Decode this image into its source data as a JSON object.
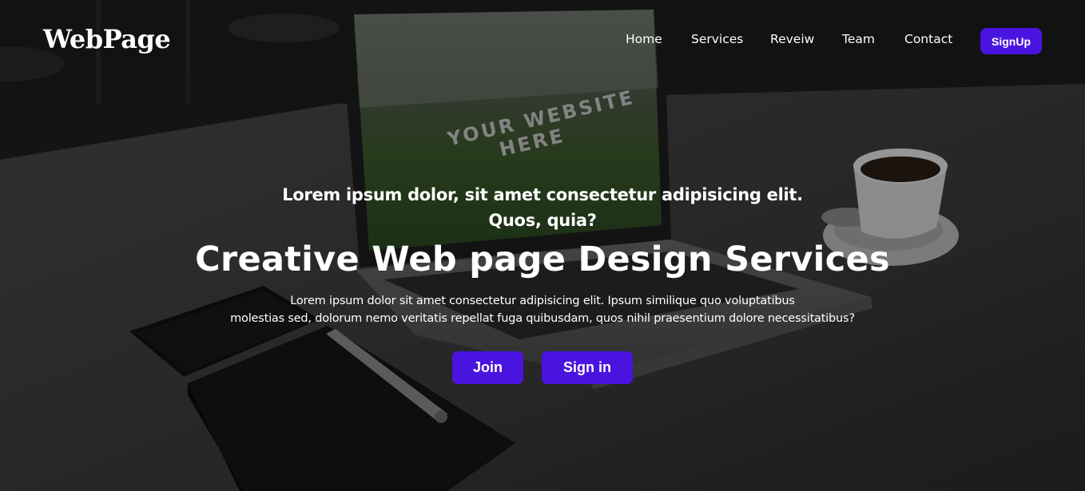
{
  "brand": {
    "logo_text": "WebPage"
  },
  "nav": {
    "items": [
      {
        "label": "Home"
      },
      {
        "label": "Services"
      },
      {
        "label": "Reveiw"
      },
      {
        "label": "Team"
      },
      {
        "label": "Contact"
      }
    ],
    "signup_label": "SignUp"
  },
  "hero": {
    "tagline_line1": "Lorem ipsum dolor, sit amet consectetur adipisicing elit.",
    "tagline_line2": "Quos, quia?",
    "headline": "Creative Web page Design Services",
    "description_line1": "Lorem ipsum dolor sit amet consectetur adipisicing elit. Ipsum similique quo voluptatibus",
    "description_line2": "molestias sed, dolorum nemo veritatis repellat fuga quibusdam, quos nihil praesentium dolore necessitatibus?",
    "join_label": "Join",
    "signin_label": "Sign in"
  },
  "background_photo": {
    "laptop_screen_text_line1": "YOUR WEBSITE",
    "laptop_screen_text_line2": "HERE"
  },
  "colors": {
    "accent": "#4a14e0",
    "text": "#ffffff",
    "overlay": "#000000"
  }
}
